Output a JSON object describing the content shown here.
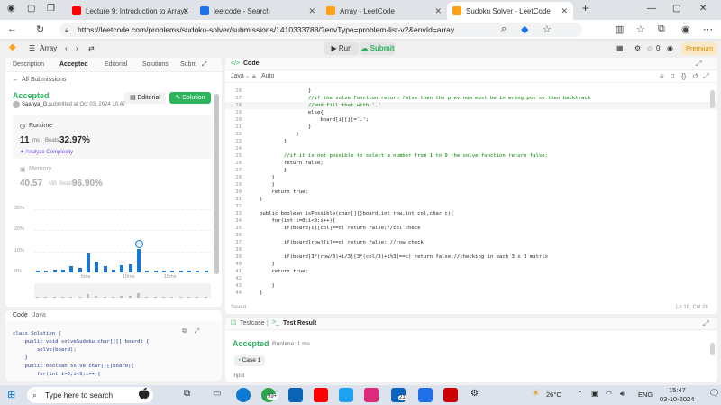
{
  "browser": {
    "tabs": [
      {
        "title": "Lecture 9: Introduction to Arrays",
        "icon_color": "#ff0000"
      },
      {
        "title": "leetcode - Search",
        "icon_color": "#1a73e8"
      },
      {
        "title": "Array - LeetCode",
        "icon_color": "#ffa116"
      },
      {
        "title": "Sudoku Solver - LeetCode",
        "icon_color": "#ffa116"
      }
    ],
    "url": "https://leetcode.com/problems/sudoku-solver/submissions/1410333788/?envType=problem-list-v2&envId=array",
    "new_tab": "+"
  },
  "lc_nav": {
    "problem_list": "Array",
    "run": "Run",
    "submit": "Submit",
    "streak": "0",
    "premium": "Premium"
  },
  "left_panel": {
    "tabs": [
      "Description",
      "Accepted",
      "Editorial",
      "Solutions",
      "Subm"
    ],
    "back_link": "All Submissions",
    "status": "Accepted",
    "author": "Saanya_G...",
    "submitted": "submitted at Oct 03, 2024 10:47",
    "editorial_btn": "Editorial",
    "solution_btn": "Solution",
    "runtime_label": "Runtime",
    "runtime_value": "11",
    "runtime_unit": "ms",
    "beats_label": "Beats",
    "runtime_beats": "32.97%",
    "analyze": "Analyze Complexity",
    "memory_label": "Memory",
    "memory_value": "40.57",
    "memory_unit": "MB",
    "memory_beats": "96.90%",
    "code_label": "Code",
    "code_lang": "Java"
  },
  "chart_data": {
    "type": "bar",
    "ylabels": [
      "30%",
      "20%",
      "10%",
      "0%"
    ],
    "xlabels": [
      "5ms",
      "10ms",
      "15ms"
    ],
    "values": [
      0.5,
      0.5,
      1.5,
      1.5,
      3,
      2,
      9,
      5,
      3,
      1.5,
      3.5,
      4,
      11,
      0.5,
      0.5,
      0.5,
      0.5,
      0.5,
      0.5,
      0.5,
      0.5
    ],
    "highlight_index": 12,
    "ylim": [
      0,
      30
    ]
  },
  "left_code": [
    "class Solution {",
    "    public void solveSudoku(char[][] board) {",
    "        solve(board);",
    "    }",
    "    public boolean solve(char[][]board){",
    "        for(int i=0;i<9;i++){"
  ],
  "editor": {
    "title": "Code",
    "lang": "Java",
    "mode": "Auto",
    "status": "Saved",
    "cursor": "Ln 18, Col 28",
    "lines": [
      {
        "n": "16",
        "t": "                }"
      },
      {
        "n": "17",
        "t": "                //if the solve Function return false then the prev num must be in wrong pos so then backtrack"
      },
      {
        "n": "18",
        "t": "                //and fill that with '.'"
      },
      {
        "n": "19",
        "t": "                else{"
      },
      {
        "n": "20",
        "t": "                    board[i][j]='.';"
      },
      {
        "n": "21",
        "t": "                }"
      },
      {
        "n": "22",
        "t": "            }"
      },
      {
        "n": "23",
        "t": "        }"
      },
      {
        "n": "24",
        "t": ""
      },
      {
        "n": "25",
        "t": "        //if it is not possible to select a number from 1 to 9 the solve function return false;"
      },
      {
        "n": "26",
        "t": "        return false;"
      },
      {
        "n": "27",
        "t": "        }"
      },
      {
        "n": "28",
        "t": "    }"
      },
      {
        "n": "29",
        "t": "    }"
      },
      {
        "n": "30",
        "t": "    return true;"
      },
      {
        "n": "31",
        "t": "}"
      },
      {
        "n": "32",
        "t": ""
      },
      {
        "n": "33",
        "t": "public boolean isPossible(char[][]board,int row,int col,char c){"
      },
      {
        "n": "34",
        "t": "    for(int i=0;i<9;i++){"
      },
      {
        "n": "35",
        "t": "        if(board[i][col]==c) return false;//col check"
      },
      {
        "n": "36",
        "t": ""
      },
      {
        "n": "37",
        "t": "        if(board[row][i]==c) return false; //row check"
      },
      {
        "n": "38",
        "t": ""
      },
      {
        "n": "39",
        "t": "        if(board[3*(row/3)+i/3][3*(col/3)+i%3]==c) return false;//checking in each 3 x 3 matrix"
      },
      {
        "n": "40",
        "t": "    }"
      },
      {
        "n": "41",
        "t": "    return true;"
      },
      {
        "n": "42",
        "t": ""
      },
      {
        "n": "43",
        "t": "    }"
      },
      {
        "n": "44",
        "t": "}"
      }
    ]
  },
  "test_panel": {
    "testcase_tab": "Testcase",
    "result_tab": "Test Result",
    "status": "Accepted",
    "runtime": "Runtime: 1 ms",
    "case": "Case 1",
    "input": "Input"
  },
  "taskbar": {
    "search_placeholder": "Type here to search",
    "badge_1": "99+",
    "badge_2": "21",
    "weather": "26°C",
    "lang": "ENG",
    "time": "15:47",
    "date": "03-10-2024"
  }
}
